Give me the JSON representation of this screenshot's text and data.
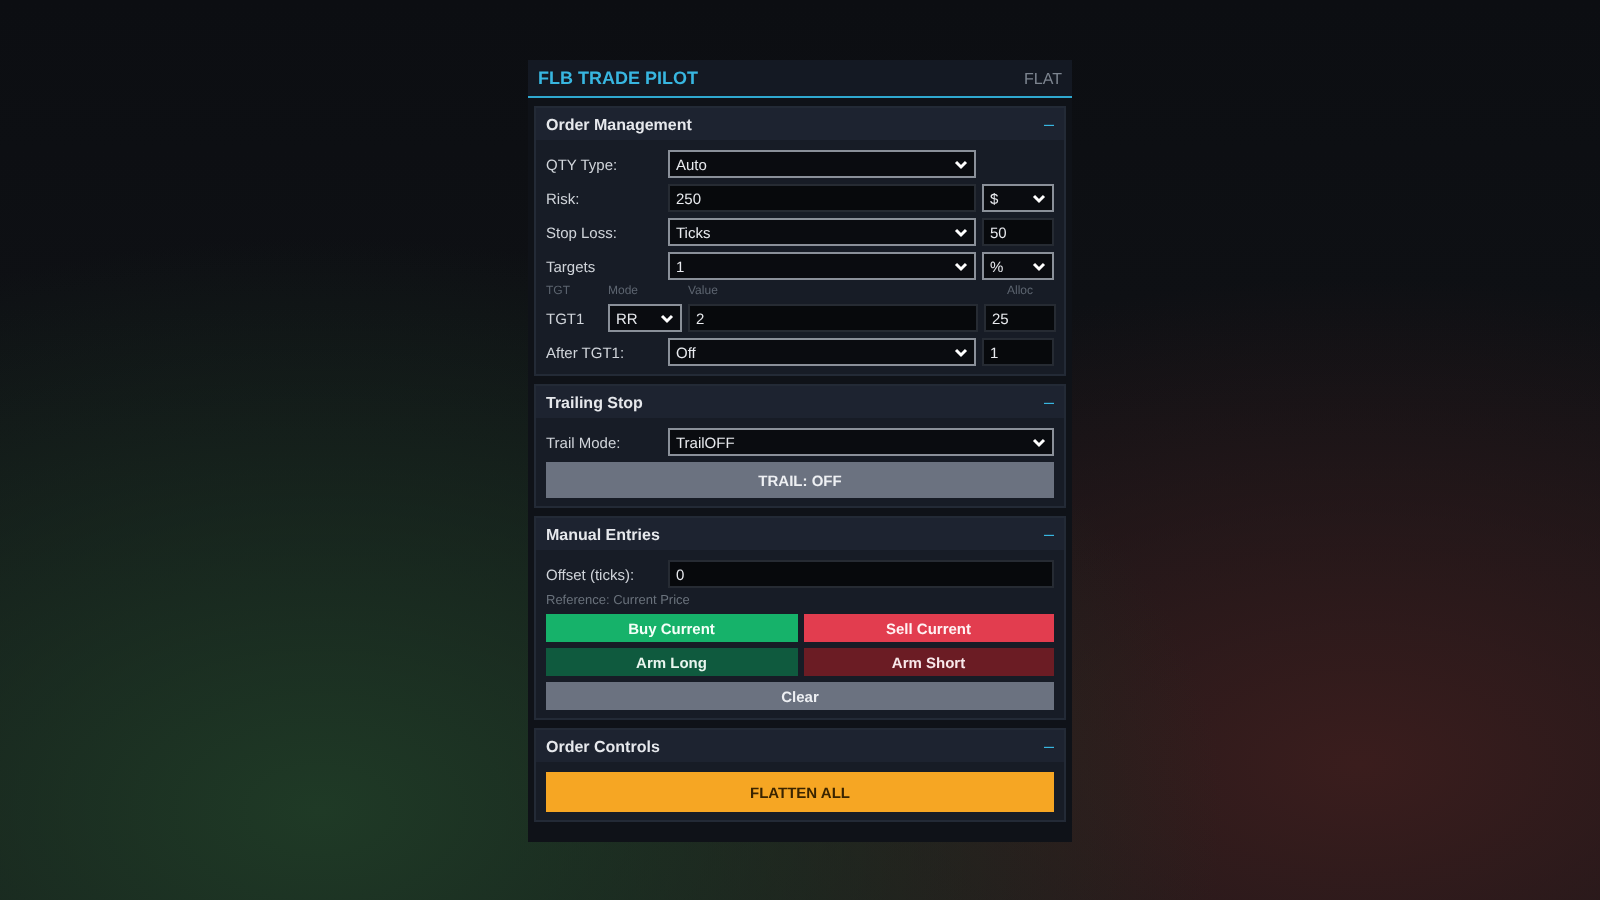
{
  "header": {
    "title": "FLB TRADE PILOT",
    "status": "FLAT"
  },
  "sections": [
    {
      "title": "Order Management",
      "toggle": "–",
      "rows": [
        {
          "kind": "field",
          "label": "QTY Type:",
          "controls": [
            {
              "kind": "select",
              "value": "Auto"
            }
          ]
        },
        {
          "kind": "field",
          "label": "Risk:",
          "controls": [
            {
              "kind": "input",
              "value": "250"
            },
            {
              "kind": "select",
              "value": "$"
            }
          ]
        },
        {
          "kind": "field",
          "label": "Stop Loss:",
          "controls": [
            {
              "kind": "select",
              "value": "Ticks"
            },
            {
              "kind": "input",
              "value": "50"
            }
          ]
        },
        {
          "kind": "field",
          "label": "Targets",
          "controls": [
            {
              "kind": "select",
              "value": "1"
            },
            {
              "kind": "select",
              "value": "%"
            }
          ]
        },
        {
          "kind": "target-head",
          "cells": [
            "TGT",
            "Mode",
            "Value",
            "Alloc"
          ]
        },
        {
          "kind": "target",
          "label": "TGT1",
          "controls": [
            {
              "kind": "select",
              "value": "RR"
            },
            {
              "kind": "input",
              "value": "2"
            },
            {
              "kind": "input",
              "value": "25"
            }
          ]
        },
        {
          "kind": "field",
          "label": "After TGT1:",
          "controls": [
            {
              "kind": "select",
              "value": "Off"
            },
            {
              "kind": "input",
              "value": "1"
            }
          ]
        }
      ]
    },
    {
      "title": "Trailing Stop",
      "toggle": "–",
      "rows": [
        {
          "kind": "field",
          "label": "Trail Mode:",
          "controls": [
            {
              "kind": "select",
              "value": "TrailOFF"
            }
          ],
          "full": true
        },
        {
          "kind": "buttons",
          "buttons": [
            {
              "label": "TRAIL: OFF",
              "kind": "neutral"
            }
          ]
        }
      ]
    },
    {
      "title": "Manual Entries",
      "toggle": "–",
      "rows": [
        {
          "kind": "field",
          "label": "Offset (ticks):",
          "controls": [
            {
              "kind": "input",
              "value": "0"
            }
          ],
          "full": true
        },
        {
          "kind": "note",
          "text": "Reference: Current Price"
        },
        {
          "kind": "buttons",
          "buttons": [
            {
              "label": "Buy Current",
              "kind": "buy"
            },
            {
              "label": "Sell Current",
              "kind": "sell"
            }
          ]
        },
        {
          "kind": "buttons",
          "buttons": [
            {
              "label": "Arm Long",
              "kind": "arm-long"
            },
            {
              "label": "Arm Short",
              "kind": "arm-short"
            }
          ]
        },
        {
          "kind": "buttons",
          "buttons": [
            {
              "label": "Clear",
              "kind": "neutral"
            }
          ]
        }
      ]
    },
    {
      "title": "Order Controls",
      "toggle": "–",
      "rows": [
        {
          "kind": "buttons",
          "buttons": [
            {
              "label": "FLATTEN ALL",
              "kind": "warning"
            }
          ]
        }
      ]
    }
  ]
}
